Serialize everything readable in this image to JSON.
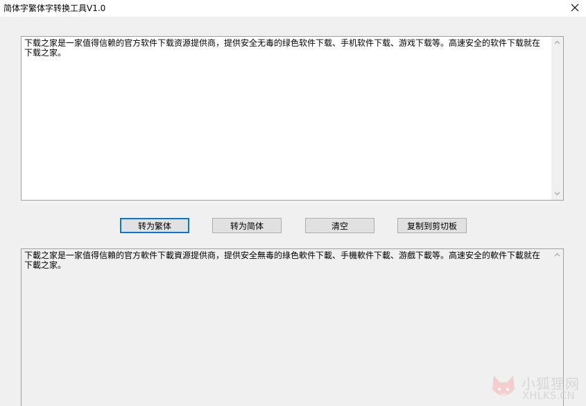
{
  "window": {
    "title": "简体字繁体字转换工具V1.0"
  },
  "input": {
    "text": "下载之家是一家值得信赖的官方软件下载资源提供商，提供安全无毒的绿色软件下载、手机软件下载、游戏下载等。高速安全的软件下载就在下载之家。"
  },
  "buttons": {
    "to_traditional": "转为繁体",
    "to_simplified": "转为简体",
    "clear": "清空",
    "copy": "复制到剪切板"
  },
  "output": {
    "text": "下載之家是一家值得信賴的官方軟件下載資源提供商，提供安全無毒的綠色軟件下載、手機軟件下載、游戲下載等。高速安全的軟件下載就在下載之家。"
  },
  "watermark": {
    "name": "小狐狸网",
    "domain": "XHLKS.CN"
  },
  "colors": {
    "window_bg": "#f0f0f0",
    "titlebar_bg": "#ffffff",
    "button_bg": "#e1e1e1",
    "focus_border": "#0078d7"
  }
}
